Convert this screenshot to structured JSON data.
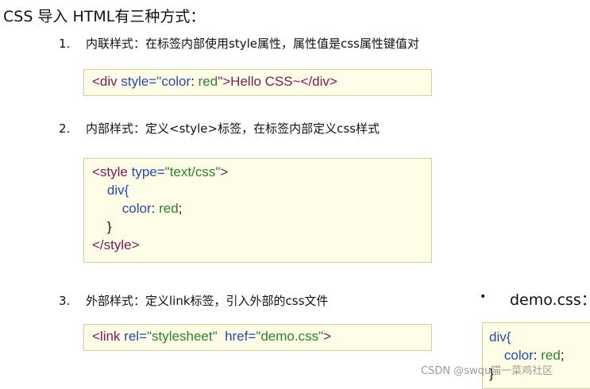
{
  "title": "CSS 导入 HTML有三种方式：",
  "items": [
    {
      "num": "1.",
      "text": "内联样式：在标签内部使用style属性，属性值是css属性键值对"
    },
    {
      "num": "2.",
      "text": "内部样式：定义<style>标签，在标签内部定义css样式"
    },
    {
      "num": "3.",
      "text": "外部样式：定义link标签，引入外部的css文件"
    }
  ],
  "code1": {
    "open": "<div ",
    "attr": "style=",
    "q": "\"",
    "prop": "color",
    "colon": ": ",
    "value": "red",
    "close": "\">Hello CSS~</div>"
  },
  "code2": {
    "l1_tag": "<style ",
    "l1_attr": "type=",
    "l1_val": "\"text/css\"",
    "l1_end": ">",
    "l2": "    div{",
    "l3_indent": "        ",
    "l3_prop": "color",
    "l3_colon": ": ",
    "l3_val": "red",
    "l3_semi": ";",
    "l4": "    }",
    "l5": "</style>"
  },
  "code3": {
    "open": "<link ",
    "attr1": "rel=",
    "val1": "\"stylesheet\"",
    "sp": "  ",
    "attr2": "href=",
    "val2": "\"demo.css\"",
    "end": ">"
  },
  "bullet": "•",
  "demo_label": "demo.css：",
  "demo": {
    "l1": "div{",
    "l2_indent": "    ",
    "l2_prop": "color",
    "l2_colon": ": ",
    "l2_val": "red",
    "l2_semi": ";",
    "l3": "}"
  },
  "watermark": "CSDN @swqu喵一菜鸡社区"
}
